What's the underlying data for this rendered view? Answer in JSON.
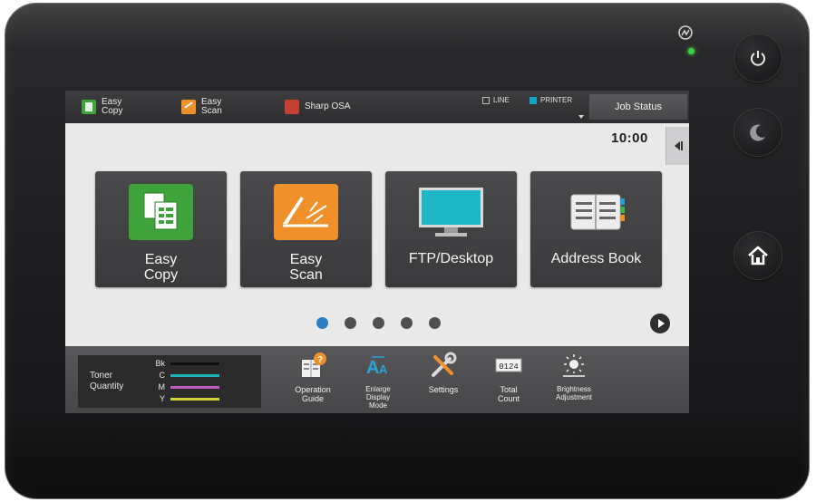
{
  "topbar": {
    "shortcuts": [
      {
        "label": "Easy\nCopy",
        "icon": "copy-icon"
      },
      {
        "label": "Easy\nScan",
        "icon": "scan-icon"
      },
      {
        "label": "Sharp OSA",
        "icon": "osa-icon"
      }
    ],
    "status_line": "LINE",
    "status_printer": "PRINTER",
    "job_status": "Job Status"
  },
  "clock": "10:00",
  "tiles": [
    {
      "label": "Easy\nCopy",
      "icon": "copy-icon"
    },
    {
      "label": "Easy\nScan",
      "icon": "scan-icon"
    },
    {
      "label": "FTP/Desktop",
      "icon": "monitor-icon"
    },
    {
      "label": "Address Book",
      "icon": "address-book-icon"
    }
  ],
  "pagination": {
    "pages": 5,
    "current": 1
  },
  "toner": {
    "title": "Toner\nQuantity",
    "items": [
      {
        "key": "Bk",
        "color": "#111111"
      },
      {
        "key": "C",
        "color": "#1fb2b8"
      },
      {
        "key": "M",
        "color": "#c05cc0"
      },
      {
        "key": "Y",
        "color": "#d3d33a"
      }
    ]
  },
  "functions": [
    {
      "label": "Operation\nGuide",
      "icon": "operation-guide-icon"
    },
    {
      "label": "Enlarge\nDisplay\nMode",
      "icon": "enlarge-display-icon"
    },
    {
      "label": "Settings",
      "icon": "settings-icon"
    },
    {
      "label": "Total\nCount",
      "icon": "counter-icon"
    },
    {
      "label": "Brightness\nAdjustment",
      "icon": "brightness-icon"
    }
  ],
  "colors": {
    "copy": "#3fa33c",
    "scan": "#f0902a",
    "printer_led": "#14a3c7",
    "page_dot_active": "#2a7fc3"
  }
}
